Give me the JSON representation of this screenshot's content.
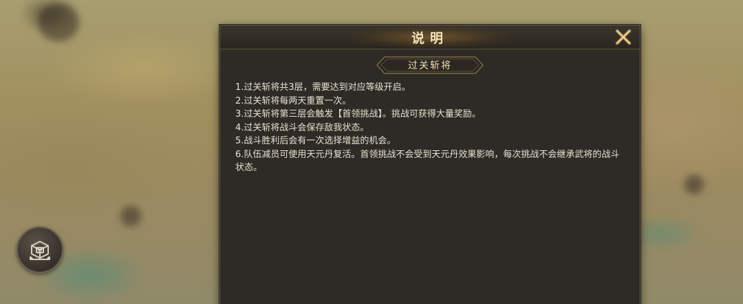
{
  "dialog": {
    "title": "说明",
    "subtitle": "过关斩将",
    "rules": [
      "1.过关斩将共3层，需要达到对应等级开启。",
      "2.过关斩将每两天重置一次。",
      "3.过关斩将第三层会触发【首领挑战】。挑战可获得大量奖励。",
      "4.过关斩将战斗会保存敌我状态。",
      "5.战斗胜利后会有一次选择增益的机会。",
      "6.队伍减员可使用天元丹复活。首领挑战不会受到天元丹效果影响，每次挑战不会继承武将的战斗状态。"
    ]
  },
  "icons": {
    "close": "close-x-icon",
    "corner": "treasure-box-icon"
  },
  "colors": {
    "dialog_bg": "#2e2b26",
    "title_text": "#f3e2bd",
    "body_text": "#e9e2d2",
    "accent_gold": "#c9a56a"
  }
}
